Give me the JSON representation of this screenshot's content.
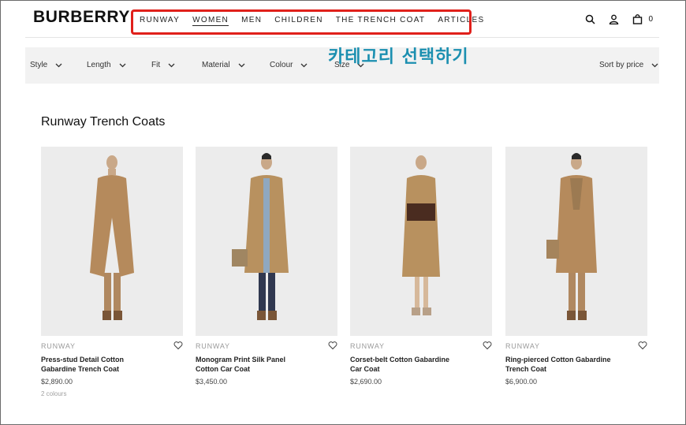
{
  "brand": {
    "logo": "BURBERRY"
  },
  "nav": {
    "items": [
      {
        "label": "RUNWAY"
      },
      {
        "label": "WOMEN"
      },
      {
        "label": "MEN"
      },
      {
        "label": "CHILDREN"
      },
      {
        "label": "THE TRENCH COAT"
      },
      {
        "label": "ARTICLES"
      }
    ],
    "active": "WOMEN"
  },
  "header": {
    "bag_count": "0",
    "icons": [
      "search-icon",
      "account-icon",
      "bag-icon"
    ]
  },
  "annotation": {
    "text": "카테고리 선택하기",
    "color": "#1b8fb0",
    "box_color": "#e0201b"
  },
  "filters": {
    "items": [
      {
        "label": "Style"
      },
      {
        "label": "Length"
      },
      {
        "label": "Fit"
      },
      {
        "label": "Material"
      },
      {
        "label": "Colour"
      },
      {
        "label": "Size"
      }
    ],
    "sort": "Sort by price"
  },
  "page": {
    "title": "Runway Trench Coats"
  },
  "products": [
    {
      "category": "RUNWAY",
      "name": "Press-stud Detail Cotton Gabardine Trench Coat",
      "price": "$2,890.00",
      "colours": "2 colours"
    },
    {
      "category": "RUNWAY",
      "name": "Monogram Print Silk Panel Cotton Car Coat",
      "price": "$3,450.00",
      "colours": ""
    },
    {
      "category": "RUNWAY",
      "name": "Corset-belt Cotton Gabardine Car Coat",
      "price": "$2,690.00",
      "colours": ""
    },
    {
      "category": "RUNWAY",
      "name": "Ring-pierced Cotton Gabardine Trench Coat",
      "price": "$6,900.00",
      "colours": ""
    }
  ]
}
